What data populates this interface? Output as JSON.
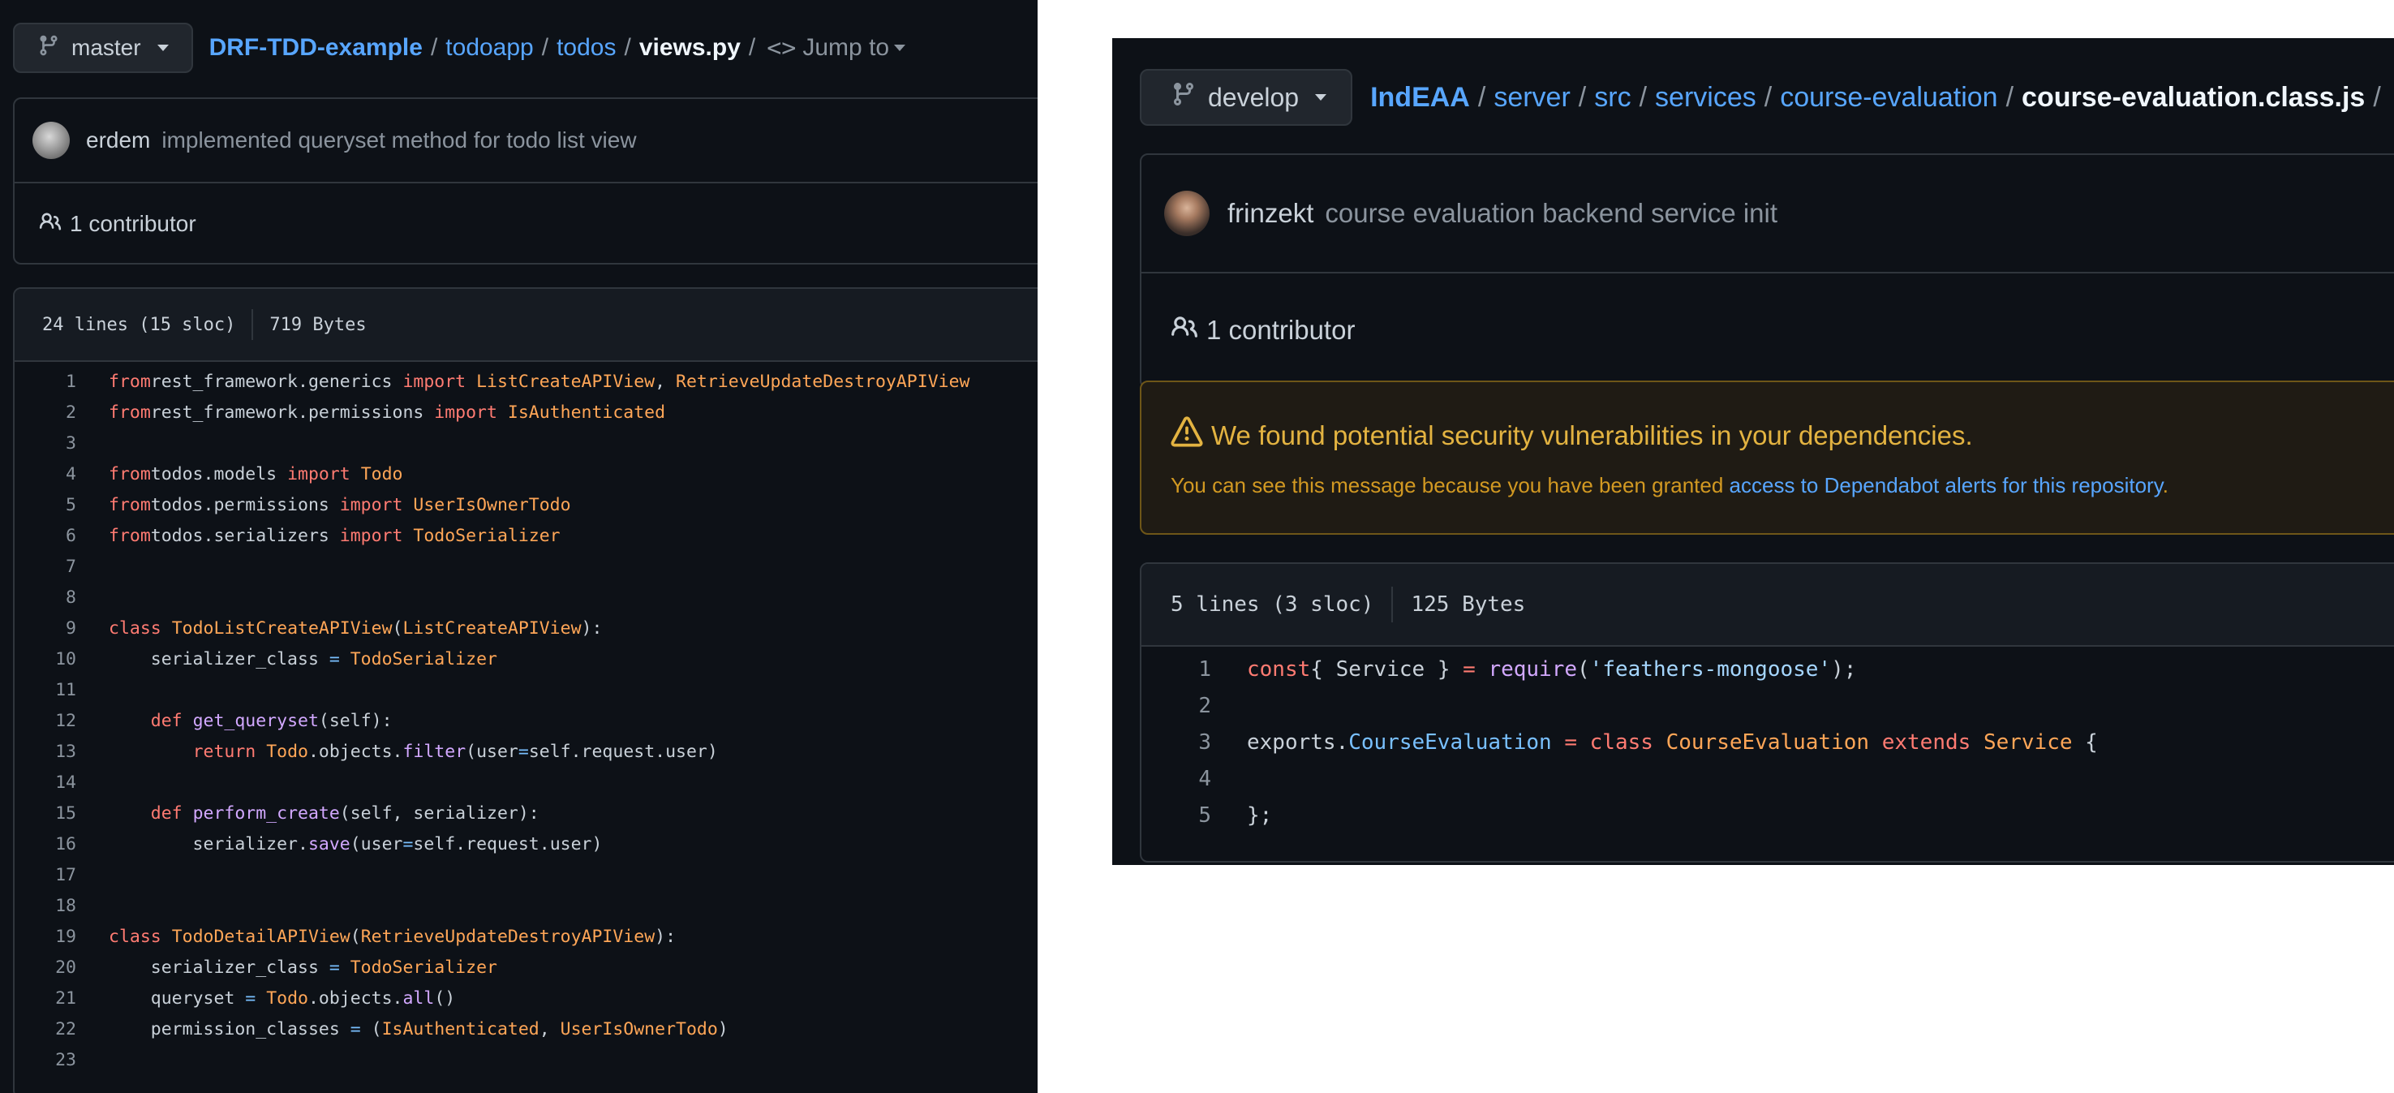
{
  "left": {
    "branch": "master",
    "breadcrumb": {
      "repo": "DRF-TDD-example",
      "sep": "/",
      "dirs": [
        "todoapp",
        "todos"
      ],
      "file": "views.py"
    },
    "jump_to": "Jump to",
    "commit": {
      "author": "erdem",
      "message": "implemented queryset method for todo list view"
    },
    "contributors": "1 contributor",
    "file_info": {
      "lines": "24 lines (15 sloc)",
      "size": "719 Bytes"
    },
    "code": [
      {
        "n": "1",
        "t": [
          [
            "kw",
            "from"
          ],
          [
            "",
            "rest_framework.generics "
          ],
          [
            "kw",
            "import"
          ],
          [
            "",
            " "
          ],
          [
            "cl",
            "ListCreateAPIView"
          ],
          [
            "",
            ", "
          ],
          [
            "cl",
            "RetrieveUpdateDestroyAPIView"
          ]
        ]
      },
      {
        "n": "2",
        "t": [
          [
            "kw",
            "from"
          ],
          [
            "",
            "rest_framework.permissions "
          ],
          [
            "kw",
            "import"
          ],
          [
            "",
            " "
          ],
          [
            "cl",
            "IsAuthenticated"
          ]
        ]
      },
      {
        "n": "3",
        "t": []
      },
      {
        "n": "4",
        "t": [
          [
            "kw",
            "from"
          ],
          [
            "",
            "todos.models "
          ],
          [
            "kw",
            "import"
          ],
          [
            "",
            " "
          ],
          [
            "cl",
            "Todo"
          ]
        ]
      },
      {
        "n": "5",
        "t": [
          [
            "kw",
            "from"
          ],
          [
            "",
            "todos.permissions "
          ],
          [
            "kw",
            "import"
          ],
          [
            "",
            " "
          ],
          [
            "cl",
            "UserIsOwnerTodo"
          ]
        ]
      },
      {
        "n": "6",
        "t": [
          [
            "kw",
            "from"
          ],
          [
            "",
            "todos.serializers "
          ],
          [
            "kw",
            "import"
          ],
          [
            "",
            " "
          ],
          [
            "cl",
            "TodoSerializer"
          ]
        ]
      },
      {
        "n": "7",
        "t": []
      },
      {
        "n": "8",
        "t": []
      },
      {
        "n": "9",
        "t": [
          [
            "kw",
            "class"
          ],
          [
            "",
            " "
          ],
          [
            "cl",
            "TodoListCreateAPIView"
          ],
          [
            "",
            "("
          ],
          [
            "cl",
            "ListCreateAPIView"
          ],
          [
            "",
            "):"
          ]
        ]
      },
      {
        "n": "10",
        "t": [
          [
            "",
            "    serializer_class "
          ],
          [
            "bi",
            "="
          ],
          [
            "",
            " "
          ],
          [
            "cl",
            "TodoSerializer"
          ]
        ]
      },
      {
        "n": "11",
        "t": []
      },
      {
        "n": "12",
        "t": [
          [
            "",
            "    "
          ],
          [
            "kw",
            "def"
          ],
          [
            "",
            " "
          ],
          [
            "fn",
            "get_queryset"
          ],
          [
            "",
            "(self):"
          ]
        ]
      },
      {
        "n": "13",
        "t": [
          [
            "",
            "        "
          ],
          [
            "kw",
            "return"
          ],
          [
            "",
            " "
          ],
          [
            "cl",
            "Todo"
          ],
          [
            "",
            ".objects."
          ],
          [
            "fn",
            "filter"
          ],
          [
            "",
            "(user"
          ],
          [
            "bi",
            "="
          ],
          [
            "",
            "self.request.user)"
          ]
        ]
      },
      {
        "n": "14",
        "t": []
      },
      {
        "n": "15",
        "t": [
          [
            "",
            "    "
          ],
          [
            "kw",
            "def"
          ],
          [
            "",
            " "
          ],
          [
            "fn",
            "perform_create"
          ],
          [
            "",
            "(self, serializer):"
          ]
        ]
      },
      {
        "n": "16",
        "t": [
          [
            "",
            "        serializer."
          ],
          [
            "fn",
            "save"
          ],
          [
            "",
            "(user"
          ],
          [
            "bi",
            "="
          ],
          [
            "",
            "self.request.user)"
          ]
        ]
      },
      {
        "n": "17",
        "t": []
      },
      {
        "n": "18",
        "t": []
      },
      {
        "n": "19",
        "t": [
          [
            "kw",
            "class"
          ],
          [
            "",
            " "
          ],
          [
            "cl",
            "TodoDetailAPIView"
          ],
          [
            "",
            "("
          ],
          [
            "cl",
            "RetrieveUpdateDestroyAPIView"
          ],
          [
            "",
            "):"
          ]
        ]
      },
      {
        "n": "20",
        "t": [
          [
            "",
            "    serializer_class "
          ],
          [
            "bi",
            "="
          ],
          [
            "",
            " "
          ],
          [
            "cl",
            "TodoSerializer"
          ]
        ]
      },
      {
        "n": "21",
        "t": [
          [
            "",
            "    queryset "
          ],
          [
            "bi",
            "="
          ],
          [
            "",
            " "
          ],
          [
            "cl",
            "Todo"
          ],
          [
            "",
            ".objects."
          ],
          [
            "fn",
            "all"
          ],
          [
            "",
            "()"
          ]
        ]
      },
      {
        "n": "22",
        "t": [
          [
            "",
            "    permission_classes "
          ],
          [
            "bi",
            "="
          ],
          [
            "",
            " ("
          ],
          [
            "cl",
            "IsAuthenticated"
          ],
          [
            "",
            ", "
          ],
          [
            "cl",
            "UserIsOwnerTodo"
          ],
          [
            "",
            ")"
          ]
        ]
      },
      {
        "n": "23",
        "t": []
      }
    ]
  },
  "right": {
    "branch": "develop",
    "breadcrumb": {
      "repo": "IndEAA",
      "sep": "/",
      "dirs": [
        "server",
        "src",
        "services",
        "course-evaluation"
      ],
      "file": "course-evaluation.class.js"
    },
    "commit": {
      "author": "frinzekt",
      "message": "course evaluation backend service init"
    },
    "contributors": "1 contributor",
    "warning": {
      "title": "We found potential security vulnerabilities in your dependencies.",
      "text": "You can see this message because you have been granted ",
      "link": "access to Dependabot alerts for this repository",
      "end": "."
    },
    "file_info": {
      "lines": "5 lines (3 sloc)",
      "size": "125 Bytes"
    },
    "code": [
      {
        "n": "1",
        "t": [
          [
            "kw",
            "const"
          ],
          [
            "",
            "{ Service } "
          ],
          [
            "kw",
            "="
          ],
          [
            "",
            " "
          ],
          [
            "fn",
            "require"
          ],
          [
            "",
            "("
          ],
          [
            "st",
            "'feathers-mongoose'"
          ],
          [
            "",
            ");"
          ]
        ]
      },
      {
        "n": "2",
        "t": []
      },
      {
        "n": "3",
        "t": [
          [
            "",
            "exports."
          ],
          [
            "bi",
            "CourseEvaluation"
          ],
          [
            "",
            " "
          ],
          [
            "kw",
            "="
          ],
          [
            "",
            " "
          ],
          [
            "kw",
            "class"
          ],
          [
            "",
            " "
          ],
          [
            "cl",
            "CourseEvaluation"
          ],
          [
            "",
            " "
          ],
          [
            "kw",
            "extends"
          ],
          [
            "",
            " "
          ],
          [
            "cl",
            "Service"
          ],
          [
            "",
            " {"
          ]
        ]
      },
      {
        "n": "4",
        "t": []
      },
      {
        "n": "5",
        "t": [
          [
            "",
            "};"
          ]
        ]
      }
    ]
  }
}
